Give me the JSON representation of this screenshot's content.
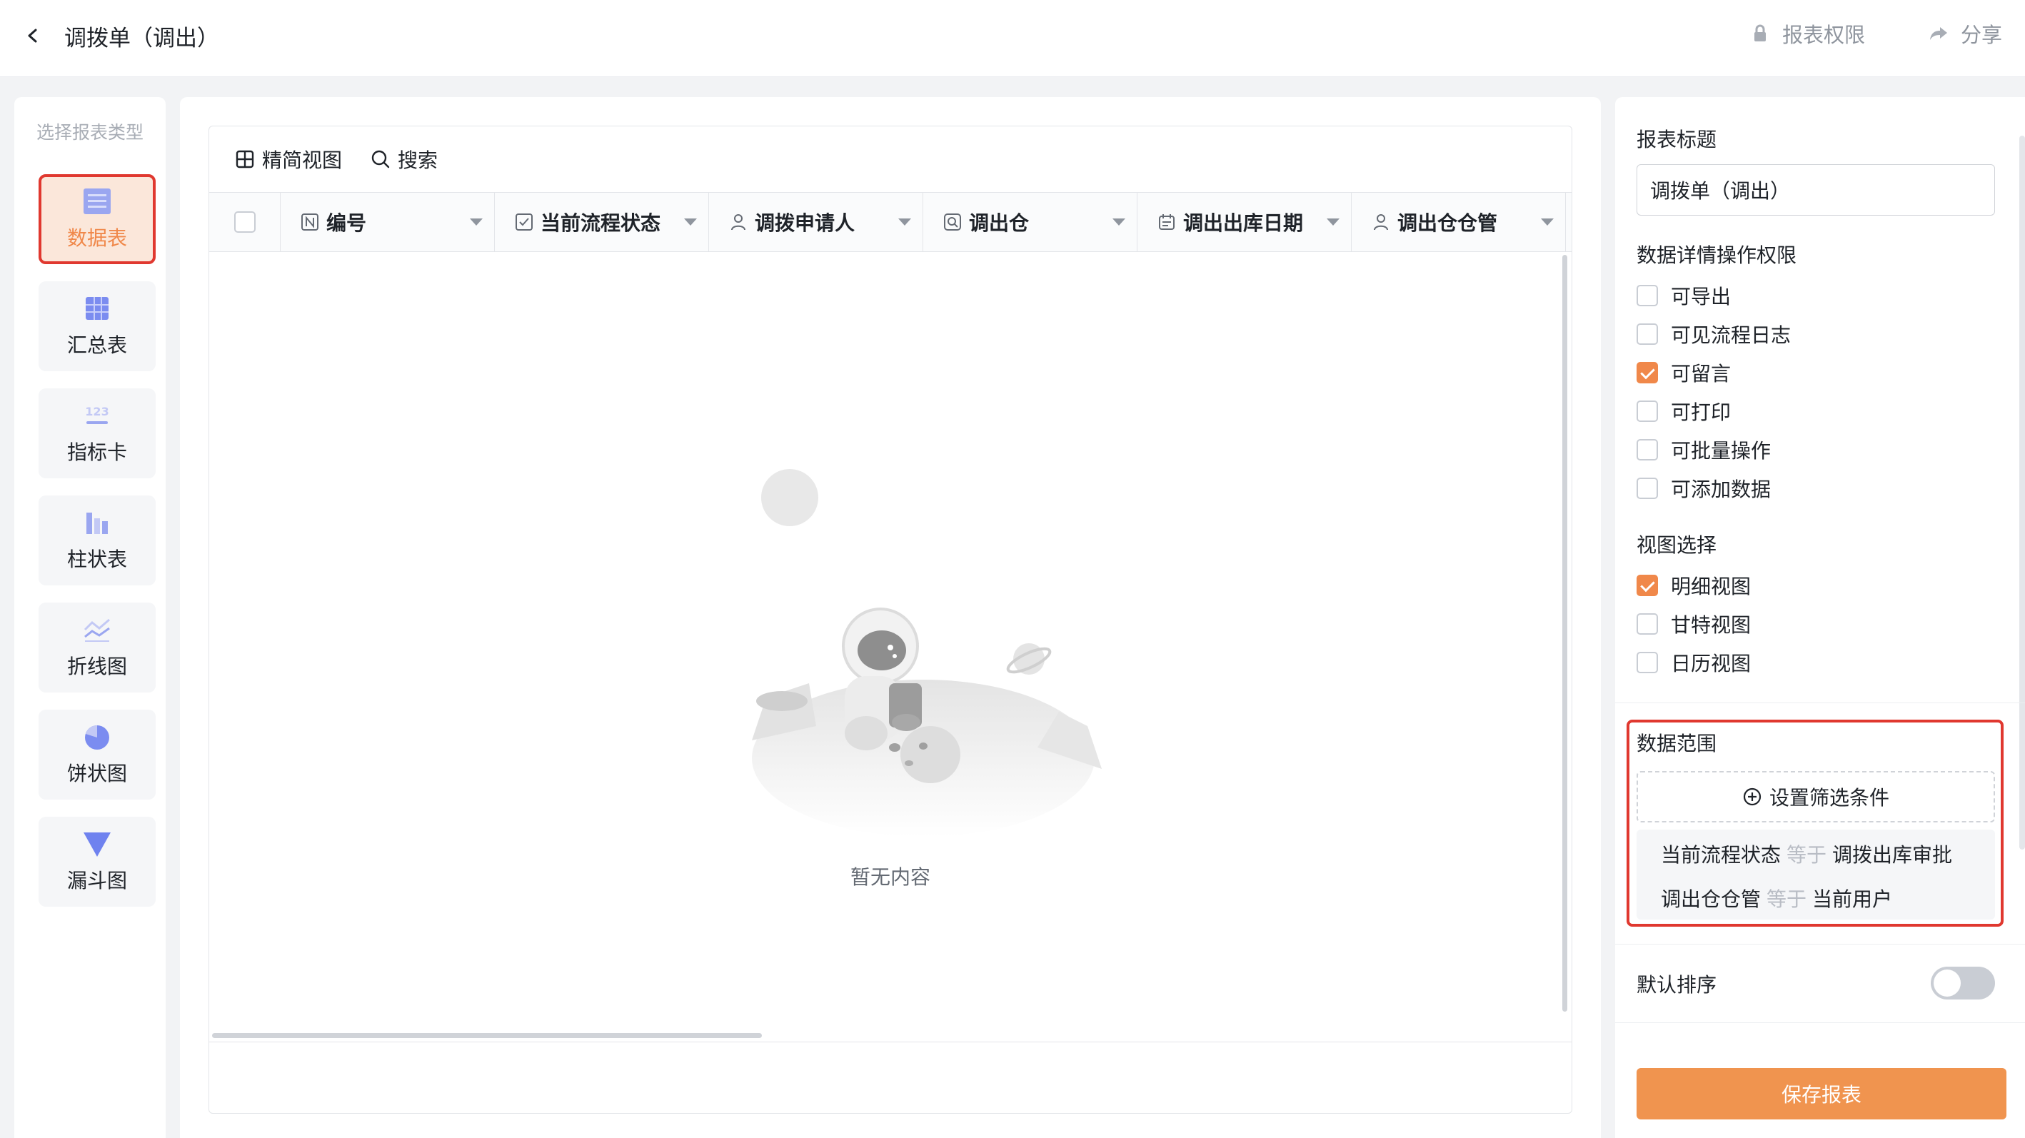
{
  "header": {
    "title": "调拨单（调出）",
    "permission_label": "报表权限",
    "share_label": "分享"
  },
  "left": {
    "heading": "选择报表类型",
    "types": [
      {
        "label": "数据表",
        "icon": "table-icon",
        "active": true
      },
      {
        "label": "汇总表",
        "icon": "pivot-table-icon",
        "active": false
      },
      {
        "label": "指标卡",
        "icon": "metric-card-icon",
        "active": false
      },
      {
        "label": "柱状表",
        "icon": "bar-chart-icon",
        "active": false
      },
      {
        "label": "折线图",
        "icon": "line-chart-icon",
        "active": false
      },
      {
        "label": "饼状图",
        "icon": "pie-chart-icon",
        "active": false
      },
      {
        "label": "漏斗图",
        "icon": "funnel-chart-icon",
        "active": false
      }
    ]
  },
  "table": {
    "toolbar": {
      "compact_view": "精简视图",
      "search": "搜索"
    },
    "columns": [
      {
        "label": "编号",
        "icon": "number-field-icon"
      },
      {
        "label": "当前流程状态",
        "icon": "checkbox-field-icon"
      },
      {
        "label": "调拨申请人",
        "icon": "user-field-icon"
      },
      {
        "label": "调出仓",
        "icon": "link-field-icon"
      },
      {
        "label": "调出出库日期",
        "icon": "date-field-icon"
      },
      {
        "label": "调出仓仓管",
        "icon": "user-field-icon"
      }
    ],
    "empty_text": "暂无内容"
  },
  "settings": {
    "report_title_label": "报表标题",
    "report_title_value": "调拨单（调出）",
    "permissions_label": "数据详情操作权限",
    "permissions": [
      {
        "label": "可导出",
        "checked": false
      },
      {
        "label": "可见流程日志",
        "checked": false
      },
      {
        "label": "可留言",
        "checked": true
      },
      {
        "label": "可打印",
        "checked": false
      },
      {
        "label": "可批量操作",
        "checked": false
      },
      {
        "label": "可添加数据",
        "checked": false
      }
    ],
    "view_label": "视图选择",
    "views": [
      {
        "label": "明细视图",
        "checked": true
      },
      {
        "label": "甘特视图",
        "checked": false
      },
      {
        "label": "日历视图",
        "checked": false
      }
    ],
    "range_label": "数据范围",
    "filter_button": "设置筛选条件",
    "conditions": [
      {
        "field": "当前流程状态",
        "op": "等于",
        "value": "调拨出库审批"
      },
      {
        "field": "调出仓仓管",
        "op": "等于",
        "value": "当前用户"
      }
    ],
    "sort_label": "默认排序",
    "sort_enabled": false,
    "save_button": "保存报表"
  },
  "colors": {
    "accent": "#f0884a",
    "highlight_border": "#e0382f",
    "save_button": "#f0944f"
  }
}
